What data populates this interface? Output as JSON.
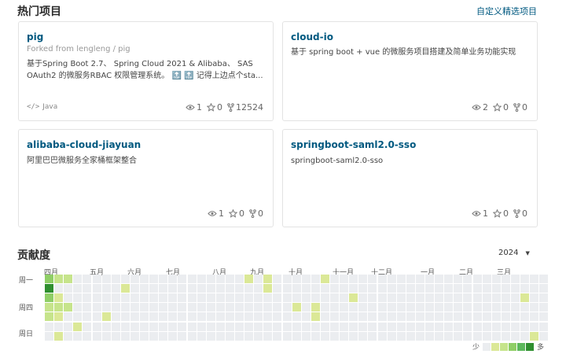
{
  "hot_projects": {
    "title": "热门项目",
    "custom_link": "自定义精选项目",
    "cards": [
      {
        "name": "pig",
        "fork": "Forked from lengleng / pig",
        "desc": [
          "基于Spring Boot 2.7、 Spring Cloud 2021 & Alibaba、 SAS",
          "OAuth2 的微服务RBAC 权限管理系统。 🔝 🔝 记得上边点个sta..."
        ],
        "lang": "Java",
        "watch": "1",
        "star": "0",
        "fork_count": "12524"
      },
      {
        "name": "cloud-io",
        "fork": "",
        "desc": [
          "基于 spring boot + vue 的微服务项目搭建及简单业务功能实现",
          ""
        ],
        "lang": "",
        "watch": "2",
        "star": "0",
        "fork_count": "0"
      },
      {
        "name": "alibaba-cloud-jiayuan",
        "fork": "",
        "desc": [
          "阿里巴巴微服务全家桶框架整合",
          ""
        ],
        "lang": "",
        "watch": "1",
        "star": "0",
        "fork_count": "0"
      },
      {
        "name": "springboot-saml2.0-sso",
        "fork": "",
        "desc": [
          "springboot-saml2.0-sso",
          ""
        ],
        "lang": "",
        "watch": "1",
        "star": "0",
        "fork_count": "0"
      }
    ]
  },
  "contribution": {
    "title": "贡献度",
    "year": "2024",
    "months": [
      "四月",
      "五月",
      "六月",
      "七月",
      "八月",
      "九月",
      "十月",
      "十一月",
      "十二月",
      "一月",
      "二月",
      "三月"
    ],
    "weekdays": [
      "周一",
      "周四",
      "周日"
    ],
    "legend_less": "少",
    "legend_more": "多",
    "colors": [
      "#ebedf0",
      "#dbe897",
      "#c6e48b",
      "#8fce66",
      "#5cb85c",
      "#2f8f2f"
    ],
    "active_cells": [
      {
        "week": 0,
        "day": 0,
        "level": 3
      },
      {
        "week": 0,
        "day": 1,
        "level": 5
      },
      {
        "week": 0,
        "day": 2,
        "level": 3
      },
      {
        "week": 0,
        "day": 3,
        "level": 2
      },
      {
        "week": 0,
        "day": 4,
        "level": 2
      },
      {
        "week": 1,
        "day": 0,
        "level": 2
      },
      {
        "week": 1,
        "day": 2,
        "level": 1
      },
      {
        "week": 1,
        "day": 3,
        "level": 2
      },
      {
        "week": 1,
        "day": 4,
        "level": 1
      },
      {
        "week": 1,
        "day": 6,
        "level": 1
      },
      {
        "week": 2,
        "day": 0,
        "level": 2
      },
      {
        "week": 2,
        "day": 3,
        "level": 2
      },
      {
        "week": 3,
        "day": 5,
        "level": 1
      },
      {
        "week": 6,
        "day": 4,
        "level": 1
      },
      {
        "week": 8,
        "day": 1,
        "level": 1
      },
      {
        "week": 21,
        "day": 0,
        "level": 1
      },
      {
        "week": 23,
        "day": 0,
        "level": 1
      },
      {
        "week": 23,
        "day": 1,
        "level": 1
      },
      {
        "week": 26,
        "day": 3,
        "level": 1
      },
      {
        "week": 28,
        "day": 3,
        "level": 1
      },
      {
        "week": 28,
        "day": 4,
        "level": 1
      },
      {
        "week": 29,
        "day": 0,
        "level": 1
      },
      {
        "week": 32,
        "day": 2,
        "level": 1
      },
      {
        "week": 50,
        "day": 2,
        "level": 1
      },
      {
        "week": 51,
        "day": 6,
        "level": 1
      }
    ]
  }
}
